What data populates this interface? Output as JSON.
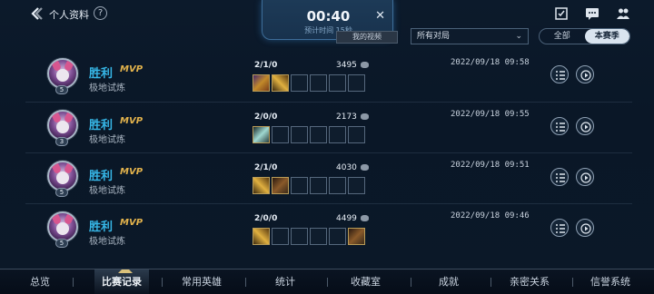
{
  "header": {
    "title": "个人资料",
    "help": "?"
  },
  "timer": {
    "time": "00:40",
    "sub": "预计时间 15秒",
    "close": "✕"
  },
  "toolbar": {
    "video_button": "我的视频",
    "filter_value": "所有对局",
    "seg_all": "全部",
    "seg_season": "本赛季"
  },
  "matches": [
    {
      "result": "胜利",
      "mvp": "MVP",
      "mode": "极地试炼",
      "level": "5",
      "kda": "2/1/0",
      "gold": "3495",
      "date": "2022/09/18 09:58"
    },
    {
      "result": "胜利",
      "mvp": "MVP",
      "mode": "极地试炼",
      "level": "3",
      "kda": "2/0/0",
      "gold": "2173",
      "date": "2022/09/18 09:55"
    },
    {
      "result": "胜利",
      "mvp": "MVP",
      "mode": "极地试炼",
      "level": "5",
      "kda": "2/1/0",
      "gold": "4030",
      "date": "2022/09/18 09:51"
    },
    {
      "result": "胜利",
      "mvp": "MVP",
      "mode": "极地试炼",
      "level": "5",
      "kda": "2/0/0",
      "gold": "4499",
      "date": "2022/09/18 09:46"
    }
  ],
  "tabs": [
    "总览",
    "比赛记录",
    "常用英雄",
    "统计",
    "收藏室",
    "成就",
    "亲密关系",
    "信誉系统"
  ],
  "colors": {
    "win": "#36b6e6",
    "mvp": "#e2b24c",
    "accent": "#d9c07a"
  }
}
